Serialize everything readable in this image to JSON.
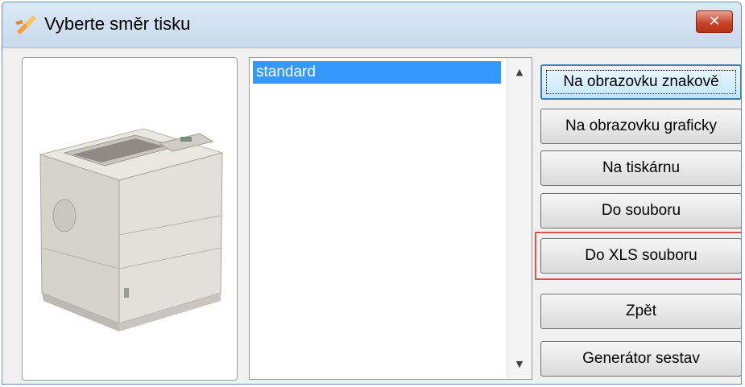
{
  "window": {
    "title": "Vyberte směr tisku"
  },
  "listbox": {
    "items": [
      "standard"
    ],
    "selected_index": 0
  },
  "buttons": {
    "screen_text": "Na obrazovku znakově",
    "screen_graphic": "Na obrazovku graficky",
    "printer": "Na tiskárnu",
    "to_file": "Do souboru",
    "to_xls": "Do XLS souboru",
    "back": "Zpět",
    "report_generator": "Generátor sestav"
  },
  "icons": {
    "title": "app-brush-icon",
    "close": "close-icon",
    "preview": "printer-image",
    "scroll_up": "scroll-up-arrow-icon",
    "scroll_down": "scroll-down-arrow-icon"
  },
  "colors": {
    "selection": "#3399ff",
    "close_button": "#c8452c",
    "highlight": "#d9534f",
    "default_button_border": "#3c7fb1"
  }
}
